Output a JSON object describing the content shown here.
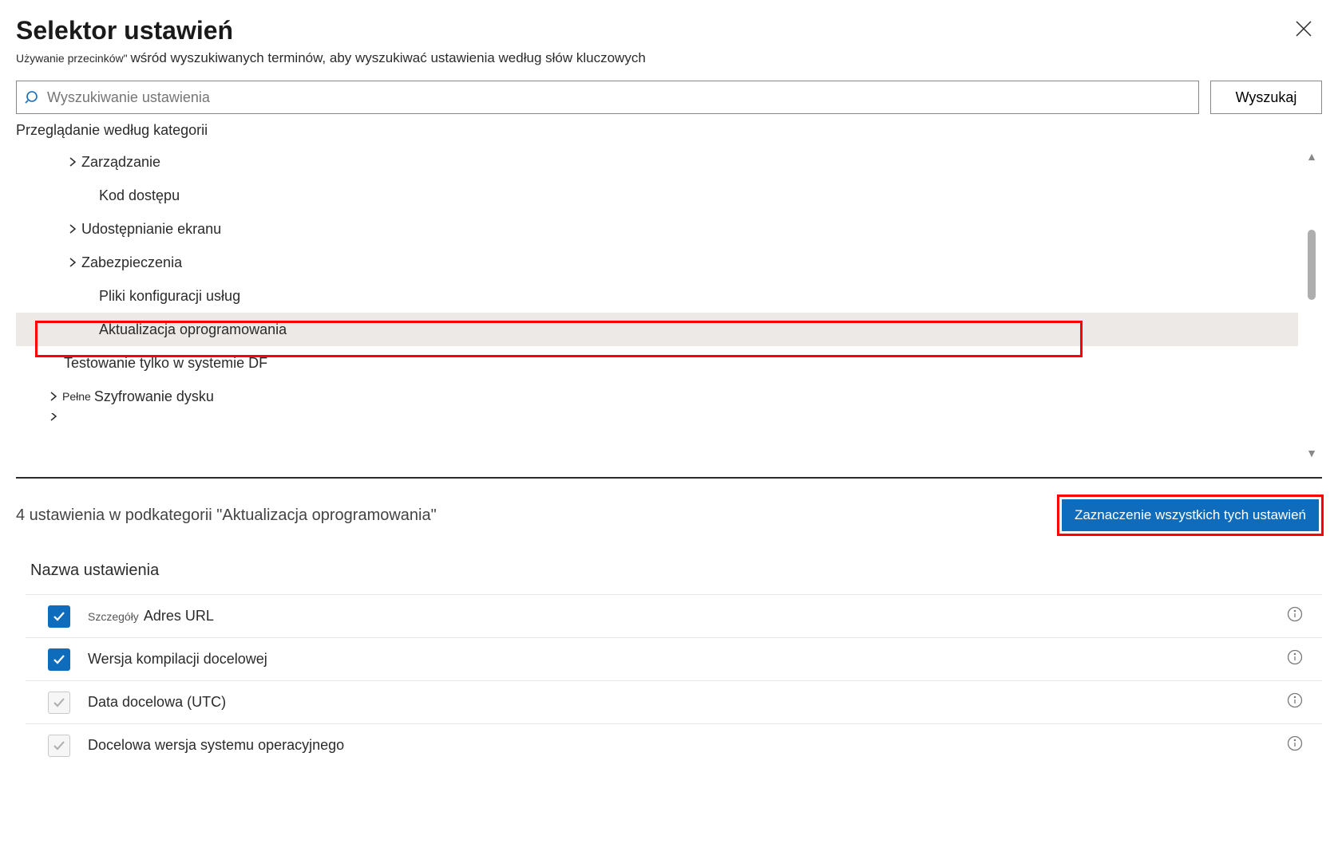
{
  "header": {
    "title": "Selektor ustawień",
    "subtitle_part1": "Używanie przecinków\" ",
    "subtitle_part2": "wśród wyszukiwanych terminów, aby wyszukiwać ustawienia według słów kluczowych"
  },
  "search": {
    "placeholder": "Wyszukiwanie ustawienia",
    "button_label": "Wyszukaj"
  },
  "browse_label": "Przeglądanie według kategorii",
  "tree": [
    {
      "label": "Zarządzanie",
      "level": 1,
      "expandable": true
    },
    {
      "label": "Kod dostępu",
      "level": 2,
      "expandable": false
    },
    {
      "label": "Udostępnianie ekranu",
      "level": 1,
      "expandable": true
    },
    {
      "label": "Zabezpieczenia",
      "level": 1,
      "expandable": true
    },
    {
      "label": "Pliki konfiguracji usług",
      "level": 2,
      "expandable": false
    },
    {
      "label": "Aktualizacja oprogramowania",
      "level": 2,
      "expandable": false,
      "selected": true
    },
    {
      "label": "Testowanie tylko w systemie DF",
      "level": 1,
      "expandable": false
    },
    {
      "label": "Szyfrowanie dysku",
      "level": 0,
      "expandable": true,
      "prefix": "Pełne"
    }
  ],
  "results": {
    "count_text": "4 ustawienia w podkategorii \"Aktualizacja oprogramowania\"",
    "select_all_label": "Zaznaczenie wszystkich tych ustawień",
    "column_header": "Nazwa ustawienia",
    "items": [
      {
        "label": "Adres URL",
        "checked": true,
        "details_prefix": "Szczegóły"
      },
      {
        "label": "Wersja kompilacji docelowej",
        "checked": true
      },
      {
        "label": "Data docelowa (UTC)",
        "checked": false
      },
      {
        "label": "Docelowa wersja systemu operacyjnego",
        "checked": false
      }
    ]
  }
}
